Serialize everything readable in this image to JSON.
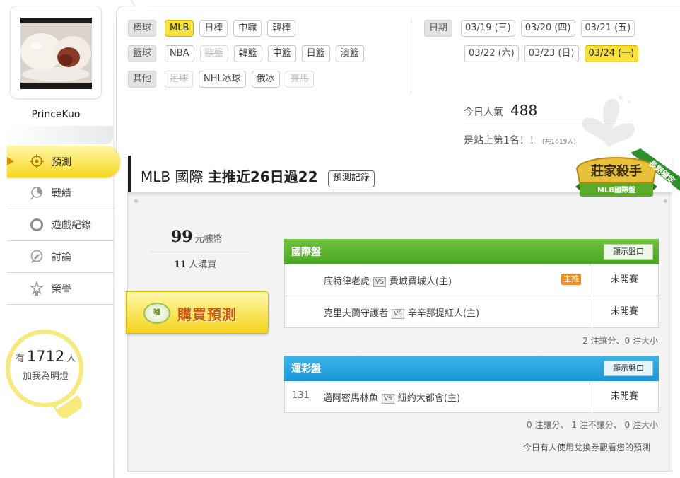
{
  "user": {
    "name": "PrinceKuo"
  },
  "nav": {
    "items": [
      {
        "label": "預測",
        "icon": "target-icon",
        "active": true
      },
      {
        "label": "戰績",
        "icon": "chart-pie-icon",
        "active": false
      },
      {
        "label": "遊戲紀錄",
        "icon": "circle-icon",
        "active": false
      },
      {
        "label": "討論",
        "icon": "chat-icon",
        "active": false
      },
      {
        "label": "榮譽",
        "icon": "medal-icon",
        "active": false
      }
    ]
  },
  "fans": {
    "prefix": "有",
    "count": "1712",
    "suffix": "人",
    "line2": "加我為明燈"
  },
  "filters": {
    "baseball": {
      "category": "棒球",
      "items": [
        "MLB",
        "日棒",
        "中職",
        "韓棒"
      ],
      "selected": "MLB"
    },
    "basketball": {
      "category": "籃球",
      "items": [
        "NBA",
        "歐籃",
        "韓籃",
        "中籃",
        "日籃",
        "澳籃"
      ],
      "disabled": [
        "歐籃"
      ]
    },
    "other": {
      "category": "其他",
      "items": [
        "足球",
        "NHL冰球",
        "俄冰",
        "賽馬"
      ],
      "disabled": [
        "足球",
        "賽馬"
      ]
    }
  },
  "dates": {
    "label": "日期",
    "row1": [
      "03/19 (三)",
      "03/20 (四)",
      "03/21 (五)"
    ],
    "row2": [
      "03/22 (六)",
      "03/23 (日)",
      "03/24 (一)"
    ],
    "selected": "03/24 (一)"
  },
  "stats": {
    "popularity_label": "今日人氣",
    "popularity_value": "488",
    "rank_text": "是站上第1名！！",
    "rank_note": "(共1619人)"
  },
  "header": {
    "league": "MLB 國際",
    "headline": "主推近26日過22",
    "record_button": "預測記錄",
    "badge_title": "莊家殺手",
    "badge_sub": "MLB國際盤",
    "badge_ribbon": "長期穩定"
  },
  "purchase": {
    "price": "99",
    "price_unit": "元噱幣",
    "buyers": "11",
    "buyers_unit": "人購買",
    "coin_text": "噱",
    "button_label": "購買預測"
  },
  "markets": [
    {
      "title": "國際盤",
      "show_button": "顯示盤口",
      "color": "#52ab2a",
      "games": [
        {
          "code": "",
          "away": "底特律老虎",
          "home": "費城費城人(主)",
          "tag": "主推",
          "status": "未開賽"
        },
        {
          "code": "",
          "away": "克里夫蘭守護者",
          "home": "辛辛那提紅人(主)",
          "tag": "",
          "status": "未開賽"
        }
      ],
      "summary": "2 注讓分、0 注大小"
    },
    {
      "title": "運彩盤",
      "show_button": "顯示盤口",
      "color": "#1e9bd9",
      "games": [
        {
          "code": "131",
          "away": "邁阿密馬林魚",
          "home": "紐約大都會(主)",
          "tag": "",
          "status": "未開賽"
        }
      ],
      "summary": "0 注讓分、 1 注不讓分、 0 注大小"
    }
  ],
  "vs_label": "VS",
  "footer_note": "今日有人使用兌換券觀看您的預測"
}
